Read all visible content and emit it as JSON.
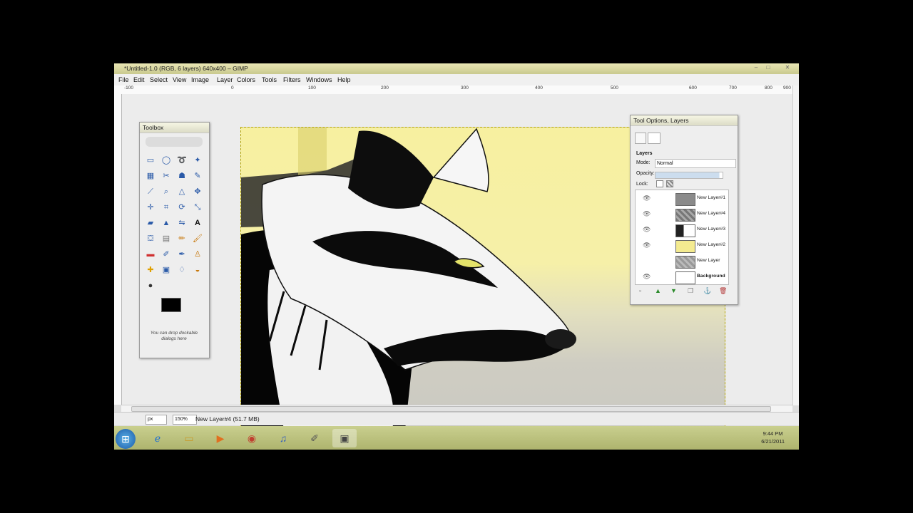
{
  "window": {
    "title": "*Untitled-1.0 (RGB, 6 layers) 640x400 – GIMP",
    "controls": [
      "–",
      "□",
      "✕"
    ]
  },
  "menu": [
    "File",
    "Edit",
    "Select",
    "View",
    "Image",
    "Layer",
    "Colors",
    "Tools",
    "Filters",
    "Windows",
    "Help"
  ],
  "ruler": {
    "ticks": [
      "-100",
      "0",
      "100",
      "200",
      "300",
      "400",
      "500",
      "600",
      "700",
      "800",
      "900"
    ]
  },
  "toolbox": {
    "title": "Toolbox",
    "dock_hint": "You can drop dockable dialogs here",
    "fg_color": "#000000",
    "bg_color": "#ffffff"
  },
  "layers_panel": {
    "title": "Tool Options, Layers",
    "tab_label": "Layers",
    "mode_label": "Mode:",
    "mode_value": "Normal",
    "opacity_label": "Opacity:",
    "lock_label": "Lock:",
    "layers": [
      {
        "name": "New Layer#1"
      },
      {
        "name": "New Layer#4"
      },
      {
        "name": "New Layer#3"
      },
      {
        "name": "New Layer#2"
      },
      {
        "name": "New Layer"
      },
      {
        "name": "Background"
      }
    ]
  },
  "status": {
    "unit": "px",
    "zoom": "150%",
    "text": "New Layer#4 (51.7 MB)"
  },
  "taskbar": {
    "time": "9:44 PM",
    "date": "6/21/2011"
  }
}
